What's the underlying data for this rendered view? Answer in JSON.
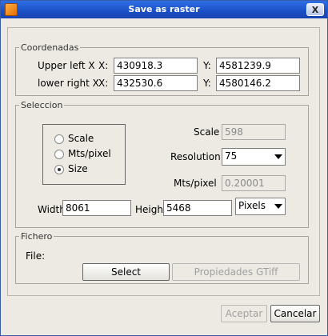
{
  "window": {
    "title": "Save as raster",
    "close_label": "X"
  },
  "coordenadas": {
    "legend": "Coordenadas",
    "upper_left_label": "Upper left X",
    "lower_right_label": "lower right X",
    "x_label": "X:",
    "y_label": "Y:",
    "upper_left_x": "430918.3",
    "upper_left_y": "4581239.9",
    "lower_right_x": "432530.6",
    "lower_right_y": "4580146.2"
  },
  "seleccion": {
    "legend": "Seleccion",
    "options": [
      "Scale",
      "Mts/pixel",
      "Size"
    ],
    "selected_option": "Size",
    "scale_label": "Scale",
    "scale_value": "598",
    "resolution_label": "Resolution",
    "resolution_value": "75",
    "mts_pixel_label": "Mts/pixel",
    "mts_pixel_value": "0.20001",
    "width_label": "Width",
    "width_value": "8061",
    "height_label": "Height",
    "height_value": "5468",
    "units_value": "Pixels"
  },
  "fichero": {
    "legend": "Fichero",
    "file_label": "File:",
    "select_label": "Select",
    "properties_label": "Propiedades GTiff"
  },
  "footer": {
    "accept_label": "Aceptar",
    "cancel_label": "Cancelar"
  }
}
